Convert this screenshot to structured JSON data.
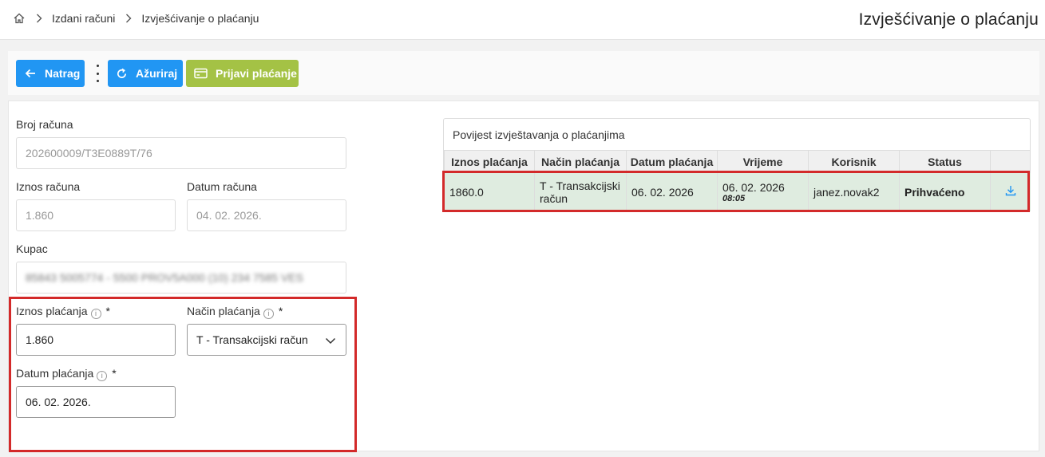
{
  "breadcrumb": {
    "home_icon": "home-icon",
    "items": [
      "Izdani računi",
      "Izvješćivanje o plaćanju"
    ]
  },
  "page_title": "Izvješćivanje o plaćanju",
  "toolbar": {
    "back_label": "Natrag",
    "update_label": "Ažuriraj",
    "report_payment_label": "Prijavi plaćanje"
  },
  "form": {
    "invoice_number": {
      "label": "Broj računa",
      "value": "202600009/T3E0889T/76"
    },
    "invoice_amount": {
      "label": "Iznos računa",
      "value": "1.860"
    },
    "invoice_date": {
      "label": "Datum računa",
      "value": "04. 02. 2026."
    },
    "customer": {
      "label": "Kupac",
      "value": "85843 5005774 - 5500 PROV5A000 (10) 234 7585 VES"
    },
    "payment_amount": {
      "label": "Iznos plaćanja",
      "required": "*",
      "value": "1.860"
    },
    "payment_method": {
      "label": "Način plaćanja",
      "required": "*",
      "value": "T - Transakcijski račun"
    },
    "payment_date": {
      "label": "Datum plaćanja",
      "required": "*",
      "value": "06. 02. 2026."
    }
  },
  "history": {
    "title": "Povijest izvještavanja o plaćanjima",
    "columns": [
      "Iznos plaćanja",
      "Način plaćanja",
      "Datum plaćanja",
      "Vrijeme",
      "Korisnik",
      "Status",
      ""
    ],
    "rows": [
      {
        "amount": "1860.0",
        "method_line1": "T - Transakcijski",
        "method_line2": "račun",
        "date": "06. 02. 2026",
        "time_date": "06. 02. 2026",
        "time_clock": "08:05",
        "user": "janez.novak2",
        "status": "Prihvaćeno"
      }
    ]
  },
  "colors": {
    "primary": "#2196f3",
    "report_button": "#a4c245",
    "highlight_border": "#d32a2a",
    "accepted_row": "#dfece0",
    "accepted_text": "#2d7d1f"
  }
}
